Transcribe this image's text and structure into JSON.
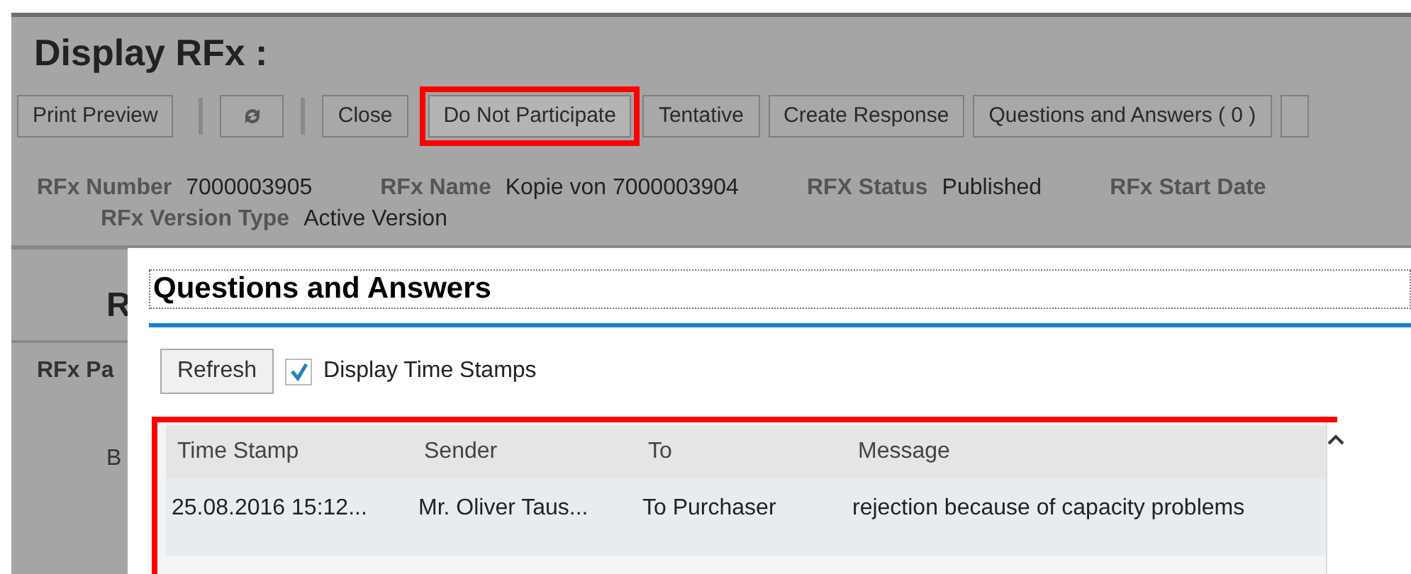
{
  "page": {
    "title": "Display RFx :"
  },
  "toolbar": [
    {
      "kind": "text",
      "label": "Print Preview",
      "highlighted": false
    },
    {
      "kind": "separator"
    },
    {
      "kind": "icon",
      "highlighted": false
    },
    {
      "kind": "separator"
    },
    {
      "kind": "text",
      "label": "Close",
      "highlighted": false
    },
    {
      "kind": "text",
      "label": "Do Not Participate",
      "highlighted": true
    },
    {
      "kind": "text",
      "label": "Tentative",
      "highlighted": false
    },
    {
      "kind": "text",
      "label": "Create Response",
      "highlighted": false
    },
    {
      "kind": "text",
      "label": "Questions and Answers ( 0 )",
      "highlighted": false
    },
    {
      "kind": "cut"
    }
  ],
  "header_fields": [
    [
      {
        "label": "RFx Number",
        "value": "7000003905"
      },
      {
        "label": "RFx Name",
        "value": "Kopie von 7000003904"
      },
      {
        "label": "RFX Status",
        "value": "Published"
      },
      {
        "label": "RFx Start Date"
      }
    ],
    [
      {
        "label": "RFx Version Type",
        "value": "Active Version"
      }
    ]
  ],
  "background_texts": [
    {
      "kind": "heading",
      "text": "R"
    },
    {
      "kind": "label",
      "text": "RFx Pa"
    },
    {
      "kind": "text",
      "text": "B"
    }
  ],
  "dialog": {
    "title": "Questions and Answers",
    "refresh_button": "Refresh",
    "display_time_stamps": {
      "label": "Display Time Stamps",
      "checked": true
    },
    "table": {
      "highlighted": true,
      "columns": [
        "Time Stamp",
        "Sender",
        "To",
        "Message"
      ],
      "rows": [
        [
          "25.08.2016 15:12...",
          "Mr. Oliver Taus...",
          "To Purchaser",
          "rejection because of capacity problems"
        ]
      ]
    }
  }
}
